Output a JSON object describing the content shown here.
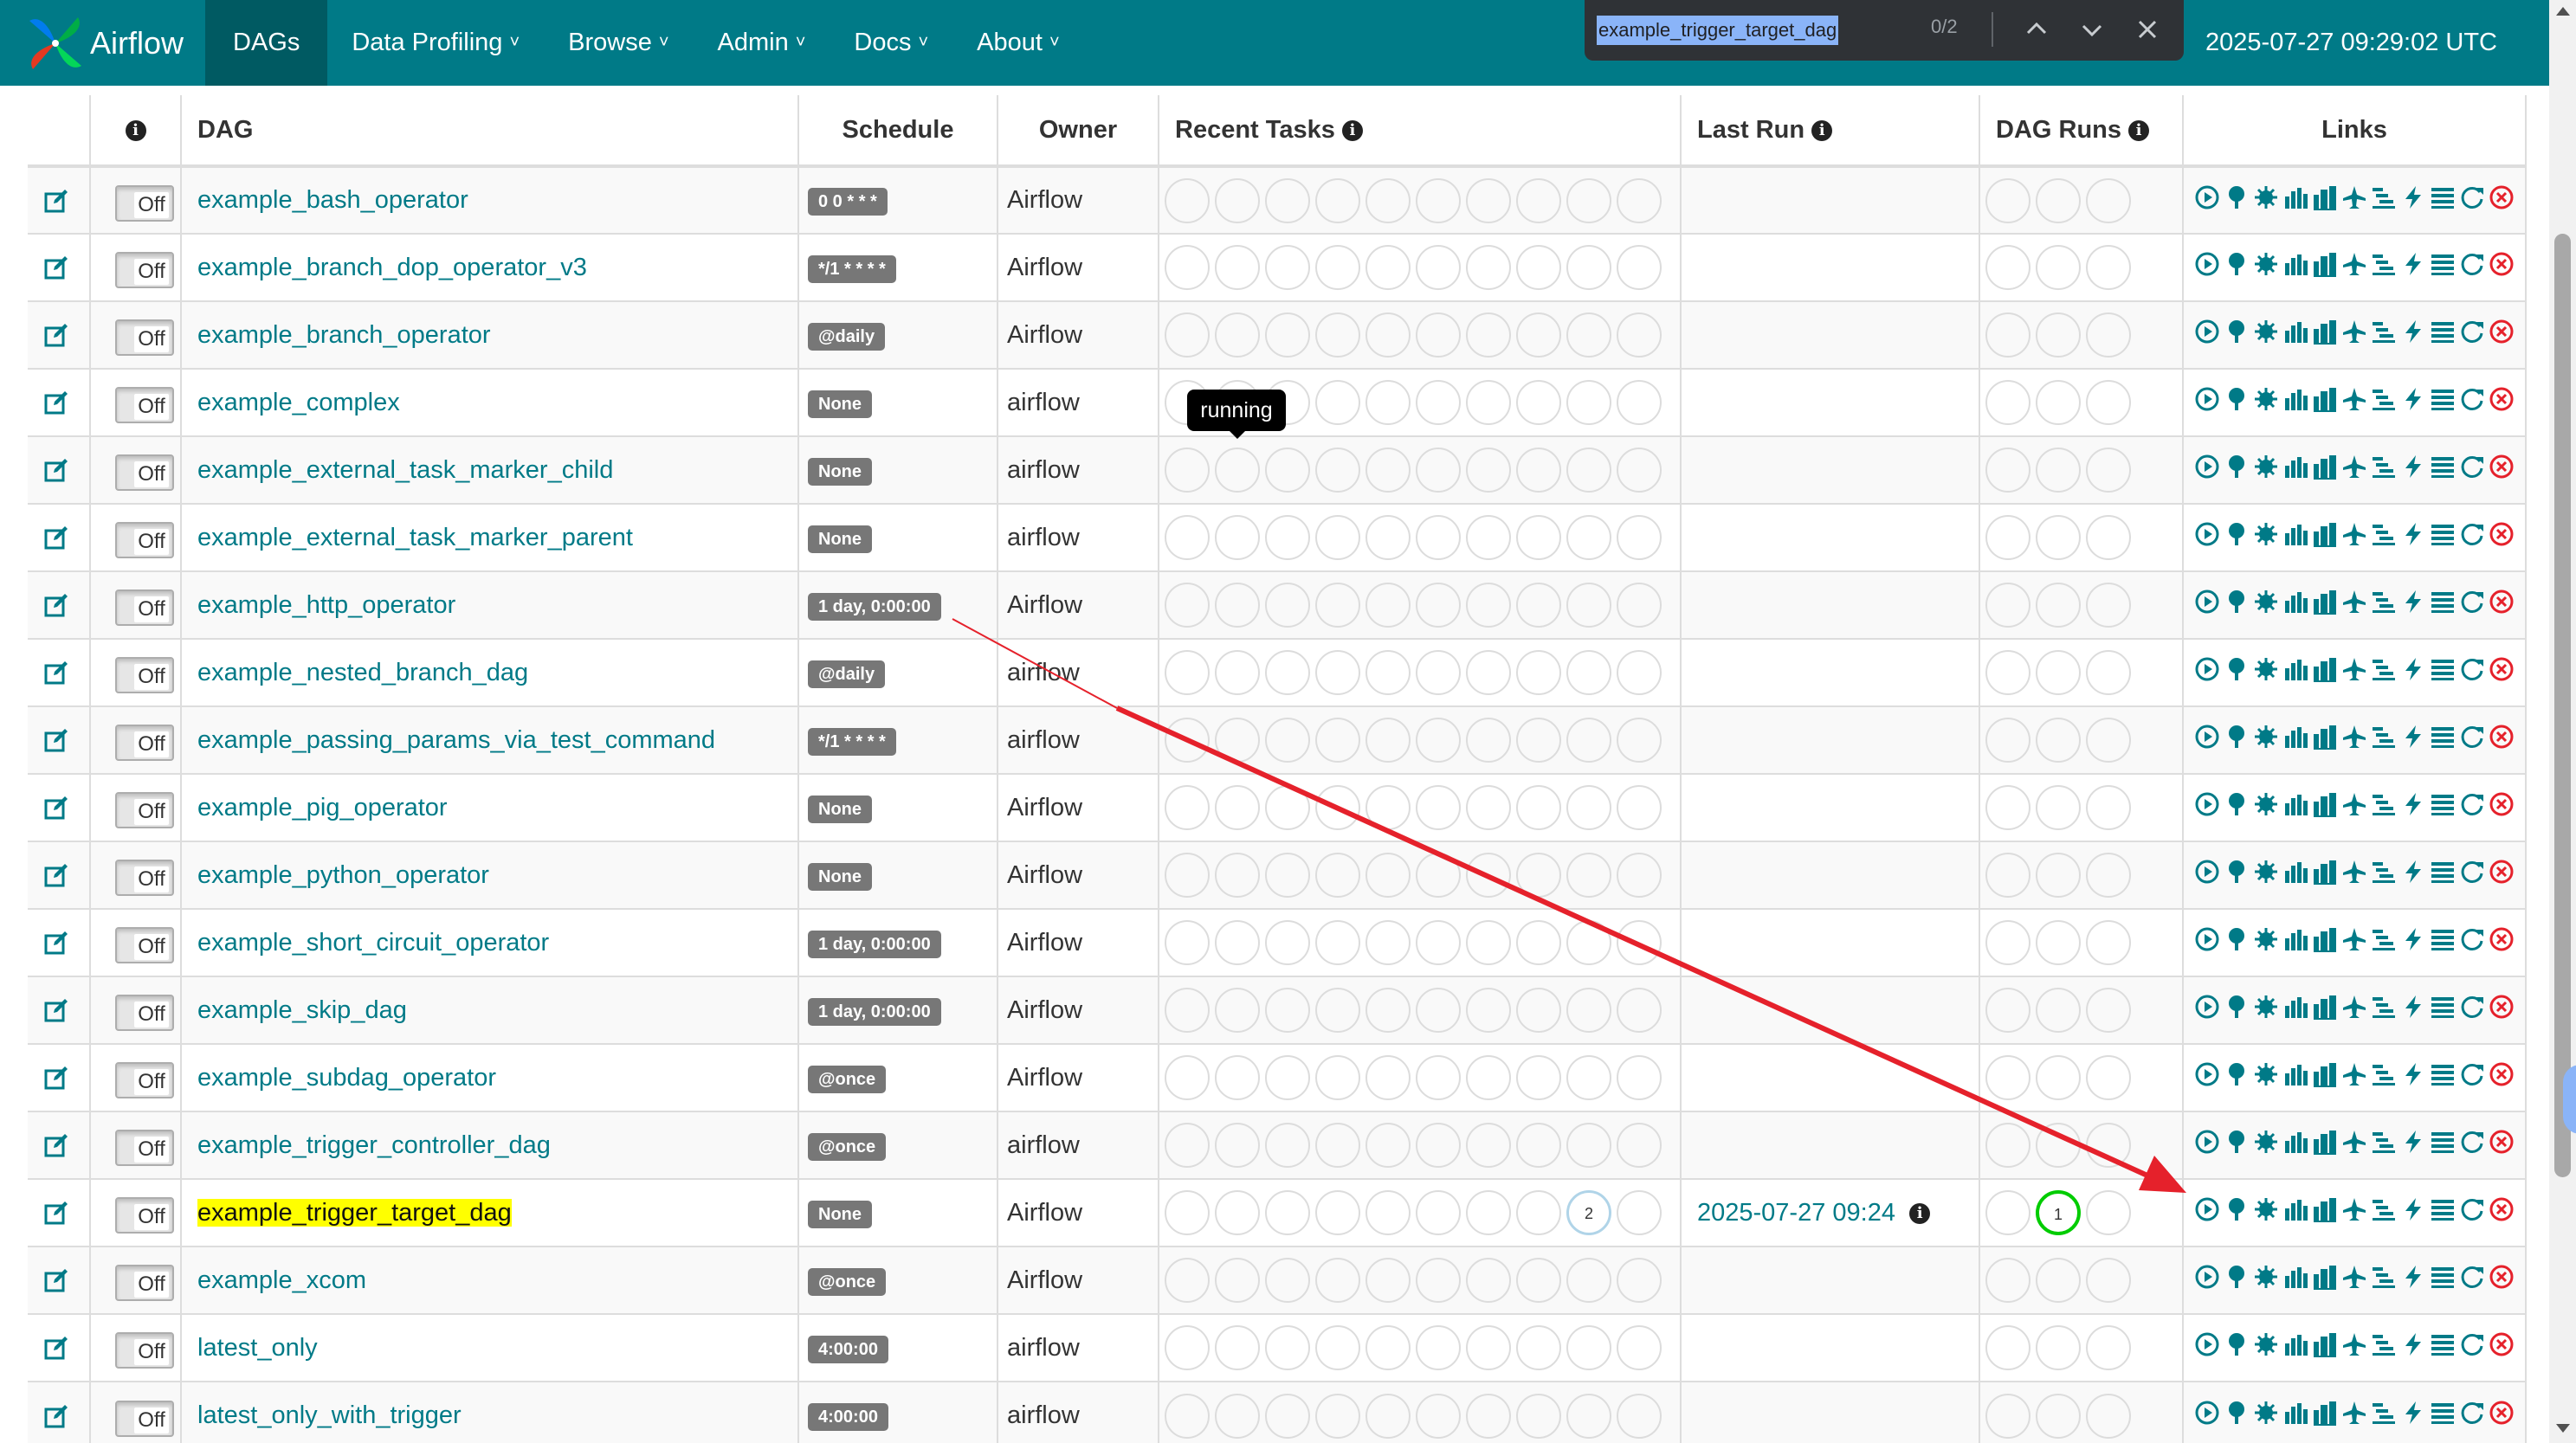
{
  "nav": {
    "brand": "Airflow",
    "items": [
      {
        "label": "DAGs",
        "caret": false,
        "active": true
      },
      {
        "label": "Data Profiling",
        "caret": true
      },
      {
        "label": "Browse",
        "caret": true
      },
      {
        "label": "Admin",
        "caret": true
      },
      {
        "label": "Docs",
        "caret": true
      },
      {
        "label": "About",
        "caret": true
      }
    ],
    "time": "2025-07-27 09:29:02 UTC"
  },
  "findbar": {
    "query": "example_trigger_target_dag",
    "count": "0/2"
  },
  "table": {
    "headers": {
      "info": "i",
      "dag": "DAG",
      "schedule": "Schedule",
      "owner": "Owner",
      "recent_tasks": "Recent Tasks",
      "last_run": "Last Run",
      "dag_runs": "DAG Runs",
      "links": "Links"
    },
    "toggle_label": "Off",
    "rows": [
      {
        "dag": "example_bash_operator",
        "schedule": "0 0 * * *",
        "owner": "Airflow"
      },
      {
        "dag": "example_branch_dop_operator_v3",
        "schedule": "*/1 * * * *",
        "owner": "Airflow"
      },
      {
        "dag": "example_branch_operator",
        "schedule": "@daily",
        "owner": "Airflow"
      },
      {
        "dag": "example_complex",
        "schedule": "None",
        "owner": "airflow"
      },
      {
        "dag": "example_external_task_marker_child",
        "schedule": "None",
        "owner": "airflow"
      },
      {
        "dag": "example_external_task_marker_parent",
        "schedule": "None",
        "owner": "airflow"
      },
      {
        "dag": "example_http_operator",
        "schedule": "1 day, 0:00:00",
        "owner": "Airflow"
      },
      {
        "dag": "example_nested_branch_dag",
        "schedule": "@daily",
        "owner": "airflow"
      },
      {
        "dag": "example_passing_params_via_test_command",
        "schedule": "*/1 * * * *",
        "owner": "airflow"
      },
      {
        "dag": "example_pig_operator",
        "schedule": "None",
        "owner": "Airflow"
      },
      {
        "dag": "example_python_operator",
        "schedule": "None",
        "owner": "Airflow"
      },
      {
        "dag": "example_short_circuit_operator",
        "schedule": "1 day, 0:00:00",
        "owner": "Airflow"
      },
      {
        "dag": "example_skip_dag",
        "schedule": "1 day, 0:00:00",
        "owner": "Airflow"
      },
      {
        "dag": "example_subdag_operator",
        "schedule": "@once",
        "owner": "Airflow"
      },
      {
        "dag": "example_trigger_controller_dag",
        "schedule": "@once",
        "owner": "airflow"
      },
      {
        "dag": "example_trigger_target_dag",
        "schedule": "None",
        "owner": "Airflow",
        "highlight": true,
        "last_run": "2025-07-27 09:24",
        "task_count_label": "2",
        "task_count_index": 8,
        "run_count_label": "1",
        "run_count_index": 1
      },
      {
        "dag": "example_xcom",
        "schedule": "@once",
        "owner": "Airflow"
      },
      {
        "dag": "latest_only",
        "schedule": "4:00:00",
        "owner": "airflow"
      },
      {
        "dag": "latest_only_with_trigger",
        "schedule": "4:00:00",
        "owner": "airflow"
      }
    ]
  },
  "tooltip": "running",
  "colors": {
    "navbar": "#007a87",
    "link": "#007a87",
    "delete": "#e5212b",
    "search_highlight": "#ffff00",
    "annotation_arrow": "#e5212b"
  },
  "link_icons": [
    "play-circle-icon",
    "tree-view-icon",
    "graph-view-icon",
    "duration-chart-icon",
    "tries-chart-icon",
    "landing-times-icon",
    "gantt-icon",
    "code-icon",
    "logs-icon",
    "refresh-icon",
    "delete-icon"
  ]
}
